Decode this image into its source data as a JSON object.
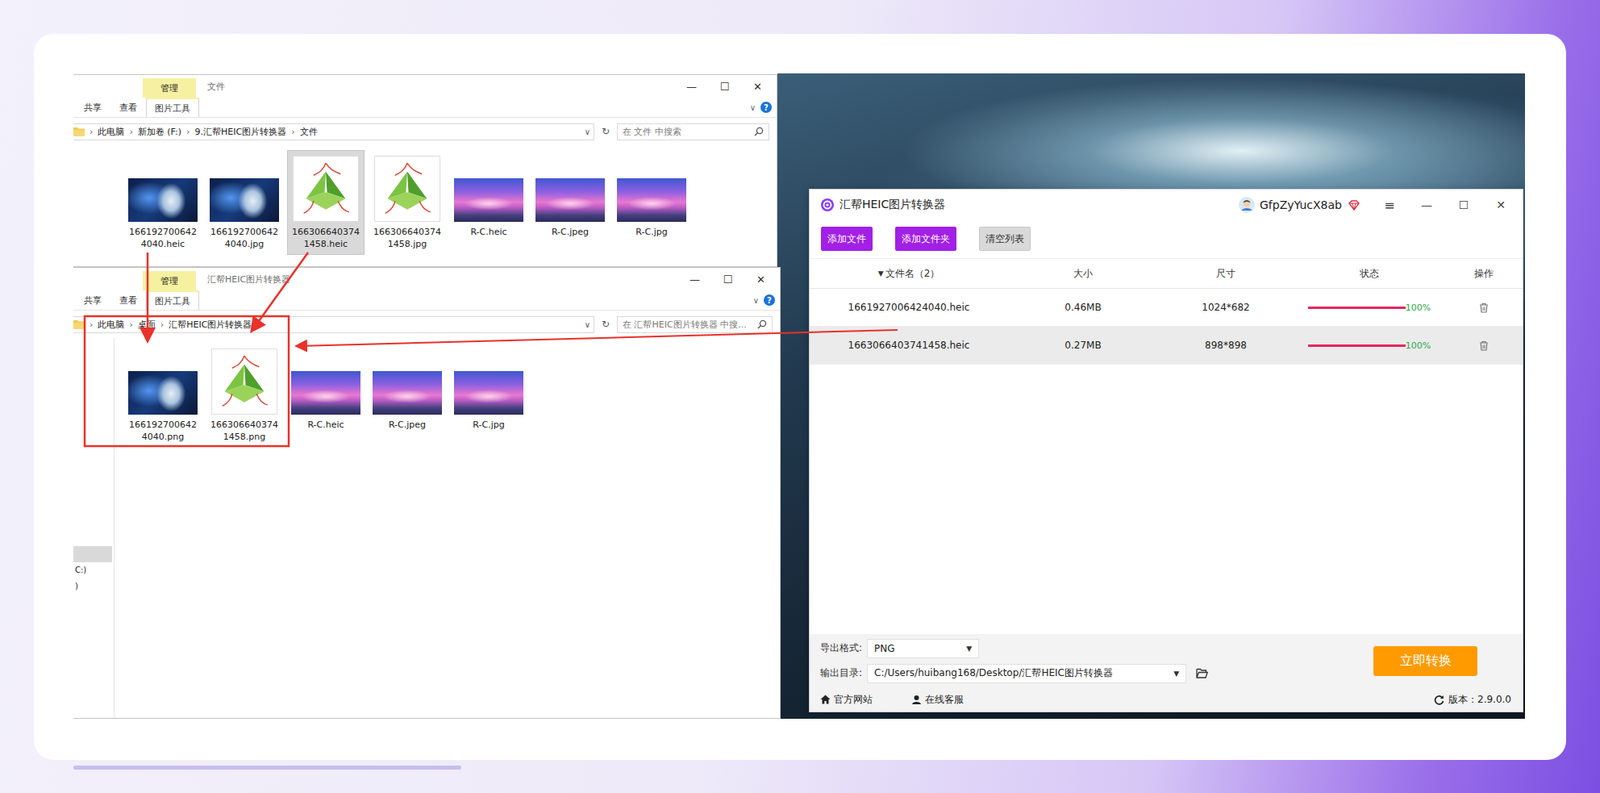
{
  "explorer_windows": [
    {
      "title": "文件",
      "context_tab": "管理",
      "ribbon_tabs": [
        {
          "label": "共享",
          "selected": false
        },
        {
          "label": "查看",
          "selected": false
        },
        {
          "label": "图片工具",
          "selected": true
        }
      ],
      "controls": [
        "—",
        "☐",
        "✕"
      ],
      "ribbon_toggle": "∨",
      "help": "?",
      "breadcrumb": [
        "此电脑",
        "新加卷 (F:)",
        "9.汇帮HEIC图片转换器",
        "文件"
      ],
      "separator": "›",
      "address_dropdown": "∨",
      "refresh": "↻",
      "search_placeholder": "在 文件 中搜索",
      "files": [
        {
          "name": "1661927006424040.heic",
          "kind": "person",
          "selected": false
        },
        {
          "name": "1661927006424040.jpg",
          "kind": "person",
          "selected": false
        },
        {
          "name": "1663066403741458.heic",
          "kind": "leaf",
          "selected": true
        },
        {
          "name": "1663066403741458.jpg",
          "kind": "leaf",
          "selected": false
        },
        {
          "name": "R-C.heic",
          "kind": "sunset",
          "selected": false
        },
        {
          "name": "R-C.jpeg",
          "kind": "sunset",
          "selected": false
        },
        {
          "name": "R-C.jpg",
          "kind": "sunset",
          "selected": false
        }
      ]
    },
    {
      "title": "汇帮HEIC图片转换器",
      "context_tab": "管理",
      "ribbon_tabs": [
        {
          "label": "共享",
          "selected": false
        },
        {
          "label": "查看",
          "selected": false
        },
        {
          "label": "图片工具",
          "selected": true
        }
      ],
      "controls": [
        "—",
        "☐",
        "✕"
      ],
      "ribbon_toggle": "∨",
      "help": "?",
      "breadcrumb": [
        "此电脑",
        "桌面",
        "汇帮HEIC图片转换器"
      ],
      "separator": "›",
      "address_dropdown": "∨",
      "refresh": "↻",
      "search_placeholder": "在 汇帮HEIC图片转换器 中搜...",
      "files": [
        {
          "name": "1661927006424040.png",
          "kind": "person",
          "selected": false
        },
        {
          "name": "1663066403741458.png",
          "kind": "leaf",
          "selected": false
        },
        {
          "name": "R-C.heic",
          "kind": "sunset",
          "selected": false
        },
        {
          "name": "R-C.jpeg",
          "kind": "sunset",
          "selected": false
        },
        {
          "name": "R-C.jpg",
          "kind": "sunset",
          "selected": false
        }
      ],
      "nav": {
        "highlight": true,
        "items": [
          "C:)",
          ")"
        ]
      }
    }
  ],
  "converter": {
    "title": "汇帮HEIC图片转换器",
    "user": "GfpZyYucX8ab",
    "menu": "≡",
    "controls": [
      "—",
      "☐",
      "✕"
    ],
    "toolbar": [
      {
        "label": "添加文件",
        "kind": "primary"
      },
      {
        "label": "添加文件夹",
        "kind": "primary"
      },
      {
        "label": "清空列表",
        "kind": "secondary"
      }
    ],
    "sort_arrow": "▼",
    "columns": [
      "文件名（2）",
      "大小",
      "尺寸",
      "状态",
      "操作"
    ],
    "rows": [
      {
        "name": "1661927006424040.heic",
        "size": "0.46MB",
        "dims": "1024*682",
        "level": 1,
        "progress": "100%",
        "selected": false
      },
      {
        "name": "1663066403741458.heic",
        "size": "0.27MB",
        "dims": "898*898",
        "level": 1,
        "progress": "100%",
        "selected": true
      }
    ],
    "format": {
      "label": "导出格式:",
      "value": "PNG",
      "arrow": "▼"
    },
    "output": {
      "label": "输出目录:",
      "value": "C:/Users/huibang168/Desktop/汇帮HEIC图片转换器",
      "arrow": "▼"
    },
    "convert_button": "立即转换",
    "footer": {
      "links": [
        "官方网站",
        "在线客服"
      ],
      "version": "版本：2.9.0.0"
    }
  }
}
